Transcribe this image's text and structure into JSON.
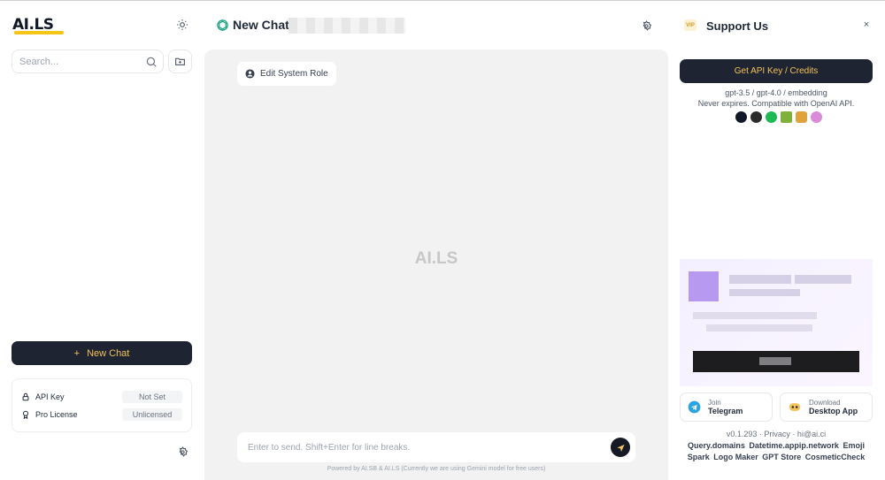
{
  "sidebar": {
    "logo": "AI.LS",
    "search_placeholder": "Search...",
    "new_chat_label": "New Chat",
    "status": [
      {
        "label": "API Key",
        "value": "Not Set"
      },
      {
        "label": "Pro License",
        "value": "Unlicensed"
      }
    ]
  },
  "main": {
    "title": "New Chat",
    "edit_role_label": "Edit System Role",
    "watermark": "AI.LS",
    "input_placeholder": "Enter to send. Shift+Enter for line breaks.",
    "footer_note": "Powered by AI.SB & AI.LS (Currently we are using Gemini model for free users)"
  },
  "panel": {
    "vip_badge": "VIP",
    "title": "Support Us",
    "close_glyph": "×",
    "api_button": "Get API Key / Credits",
    "models_line": "gpt-3.5 / gpt-4.0 / embedding",
    "compat_line": "Never expires. Compatible with OpenAI API.",
    "telegram": {
      "small": "Join",
      "big": "Telegram"
    },
    "desktop": {
      "small": "Download",
      "big": "Desktop App"
    },
    "version_line": "v0.1.293 · Privacy · hi@ai.ci",
    "links": [
      "Query.domains",
      "Datetime.appip.network",
      "Emoji",
      "Spark",
      "Logo Maker",
      "GPT Store",
      "CosmeticCheck"
    ]
  },
  "colors": {
    "accent": "#f3c25a",
    "dark_button": "#1f2433",
    "chat_bg": "#f2f2f3",
    "logo_underline": "#f5c518"
  }
}
